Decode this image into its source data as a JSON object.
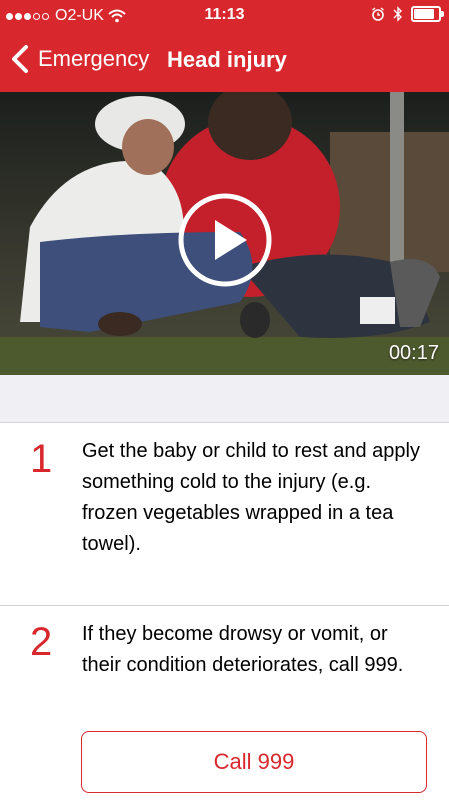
{
  "status_bar": {
    "carrier": "O2-UK",
    "time": "11:13",
    "battery_level": 0.9
  },
  "nav": {
    "back_label": "Emergency",
    "title": "Head injury"
  },
  "video": {
    "duration": "00:17"
  },
  "steps": [
    {
      "number": "1",
      "text": "Get the baby or child to rest and apply something cold to the injury (e.g. frozen vegetables wrapped in a tea towel)."
    },
    {
      "number": "2",
      "text": "If they become drowsy or vomit, or their condition deteriorates, call 999."
    }
  ],
  "call_button": {
    "label": "Call 999"
  },
  "colors": {
    "accent": "#d8272d",
    "separator": "#efeff4"
  },
  "icons": [
    "signal-dots-icon",
    "wifi-icon",
    "alarm-icon",
    "bluetooth-icon",
    "battery-icon",
    "chevron-left-icon",
    "play-icon"
  ]
}
